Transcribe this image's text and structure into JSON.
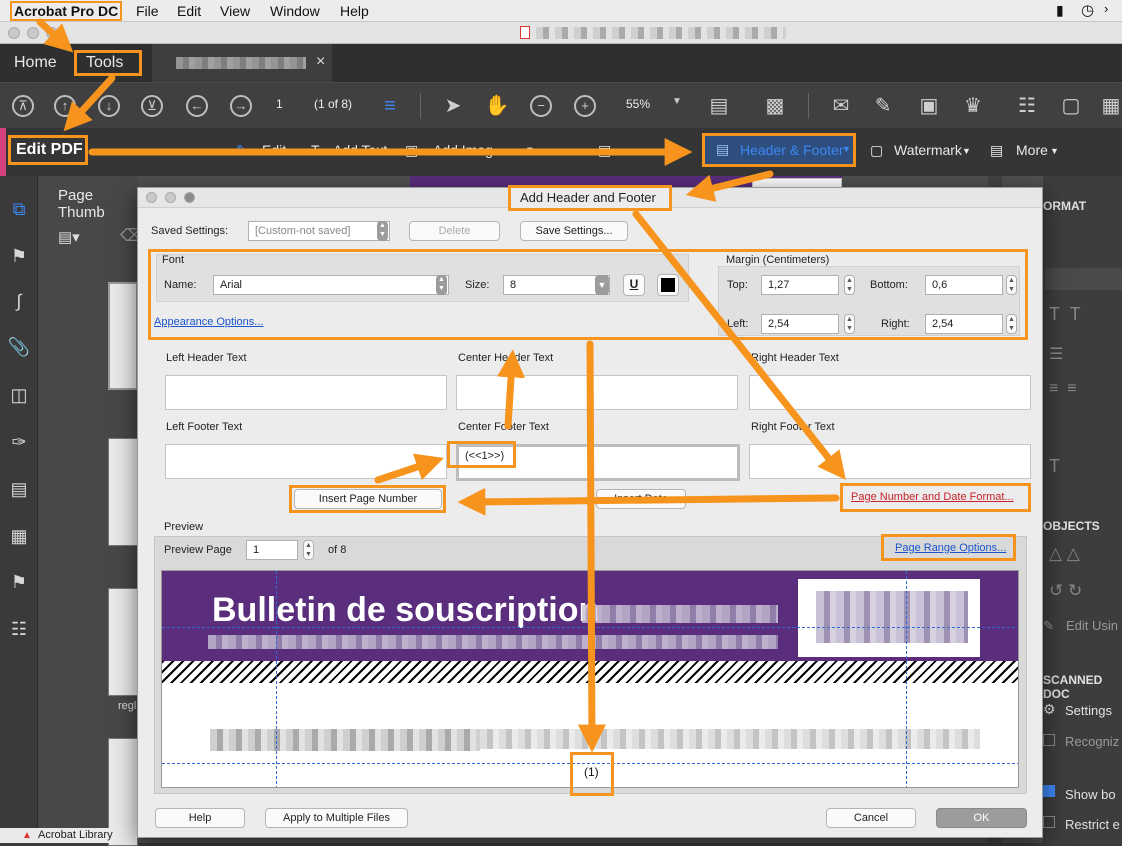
{
  "menubar": {
    "app_name": "Acrobat Pro DC",
    "items": [
      "File",
      "Edit",
      "View",
      "Window",
      "Help"
    ]
  },
  "tabs": {
    "home": "Home",
    "tools": "Tools",
    "close_glyph": "×"
  },
  "toolbar": {
    "page_number": "1",
    "page_count": "(1 of 8)",
    "zoom": "55%"
  },
  "editbar": {
    "title": "Edit PDF",
    "edit": "Edit",
    "add_text": "Add Text",
    "add_image": "Add Imag",
    "header_footer": "Header & Footer",
    "watermark": "Watermark",
    "more": "More"
  },
  "thumbs": {
    "title": "Page Thumb",
    "page_label": "regl"
  },
  "rightpanel": {
    "format": "ORMAT",
    "objects": "OBJECTS",
    "edit_using": "Edit Usin",
    "scanned": "SCANNED DOC",
    "settings": "Settings",
    "recognize": "Recogniz",
    "show_box": "Show bo",
    "restrict": "Restrict e"
  },
  "bottom_bar": {
    "acrobat_library": "Acrobat Library"
  },
  "dialog": {
    "title": "Add Header and Footer",
    "saved_settings_label": "Saved Settings:",
    "saved_settings_value": "[Custom-not saved]",
    "delete_btn": "Delete",
    "save_settings_btn": "Save Settings...",
    "font_group": "Font",
    "name_label": "Name:",
    "font_name": "Arial",
    "size_label": "Size:",
    "font_size": "8",
    "underline_glyph": "U",
    "appearance_options": "Appearance Options...",
    "margin_group": "Margin (Centimeters)",
    "top_label": "Top:",
    "top_value": "1,27",
    "bottom_label": "Bottom:",
    "bottom_value": "0,6",
    "left_label": "Left:",
    "left_value": "2,54",
    "right_label": "Right:",
    "right_value": "2,54",
    "left_header_label": "Left Header Text",
    "center_header_label": "Center Header Text",
    "right_header_label": "Right Header Text",
    "left_footer_label": "Left Footer Text",
    "center_footer_label": "Center Footer Text",
    "right_footer_label": "Right Footer Text",
    "center_footer_value": "(<<1>>)",
    "insert_page_number_btn": "Insert Page Number",
    "insert_date_btn": "Insert Date",
    "page_number_date_format": "Page Number and Date Format...",
    "preview_label": "Preview",
    "preview_page_label": "Preview Page",
    "preview_page_value": "1",
    "preview_page_total": "of 8",
    "page_range_options": "Page Range Options...",
    "preview_heading": "Bulletin de souscription",
    "preview_footer_text": "(1)",
    "help_btn": "Help",
    "apply_multiple_btn": "Apply to Multiple Files",
    "cancel_btn": "Cancel",
    "ok_btn": "OK"
  },
  "colors": {
    "annotation": "#f7941d",
    "accent_link": "#1a55cc",
    "header_footer_active": "#3d87f5",
    "preview_banner": "#5a2d7d"
  }
}
